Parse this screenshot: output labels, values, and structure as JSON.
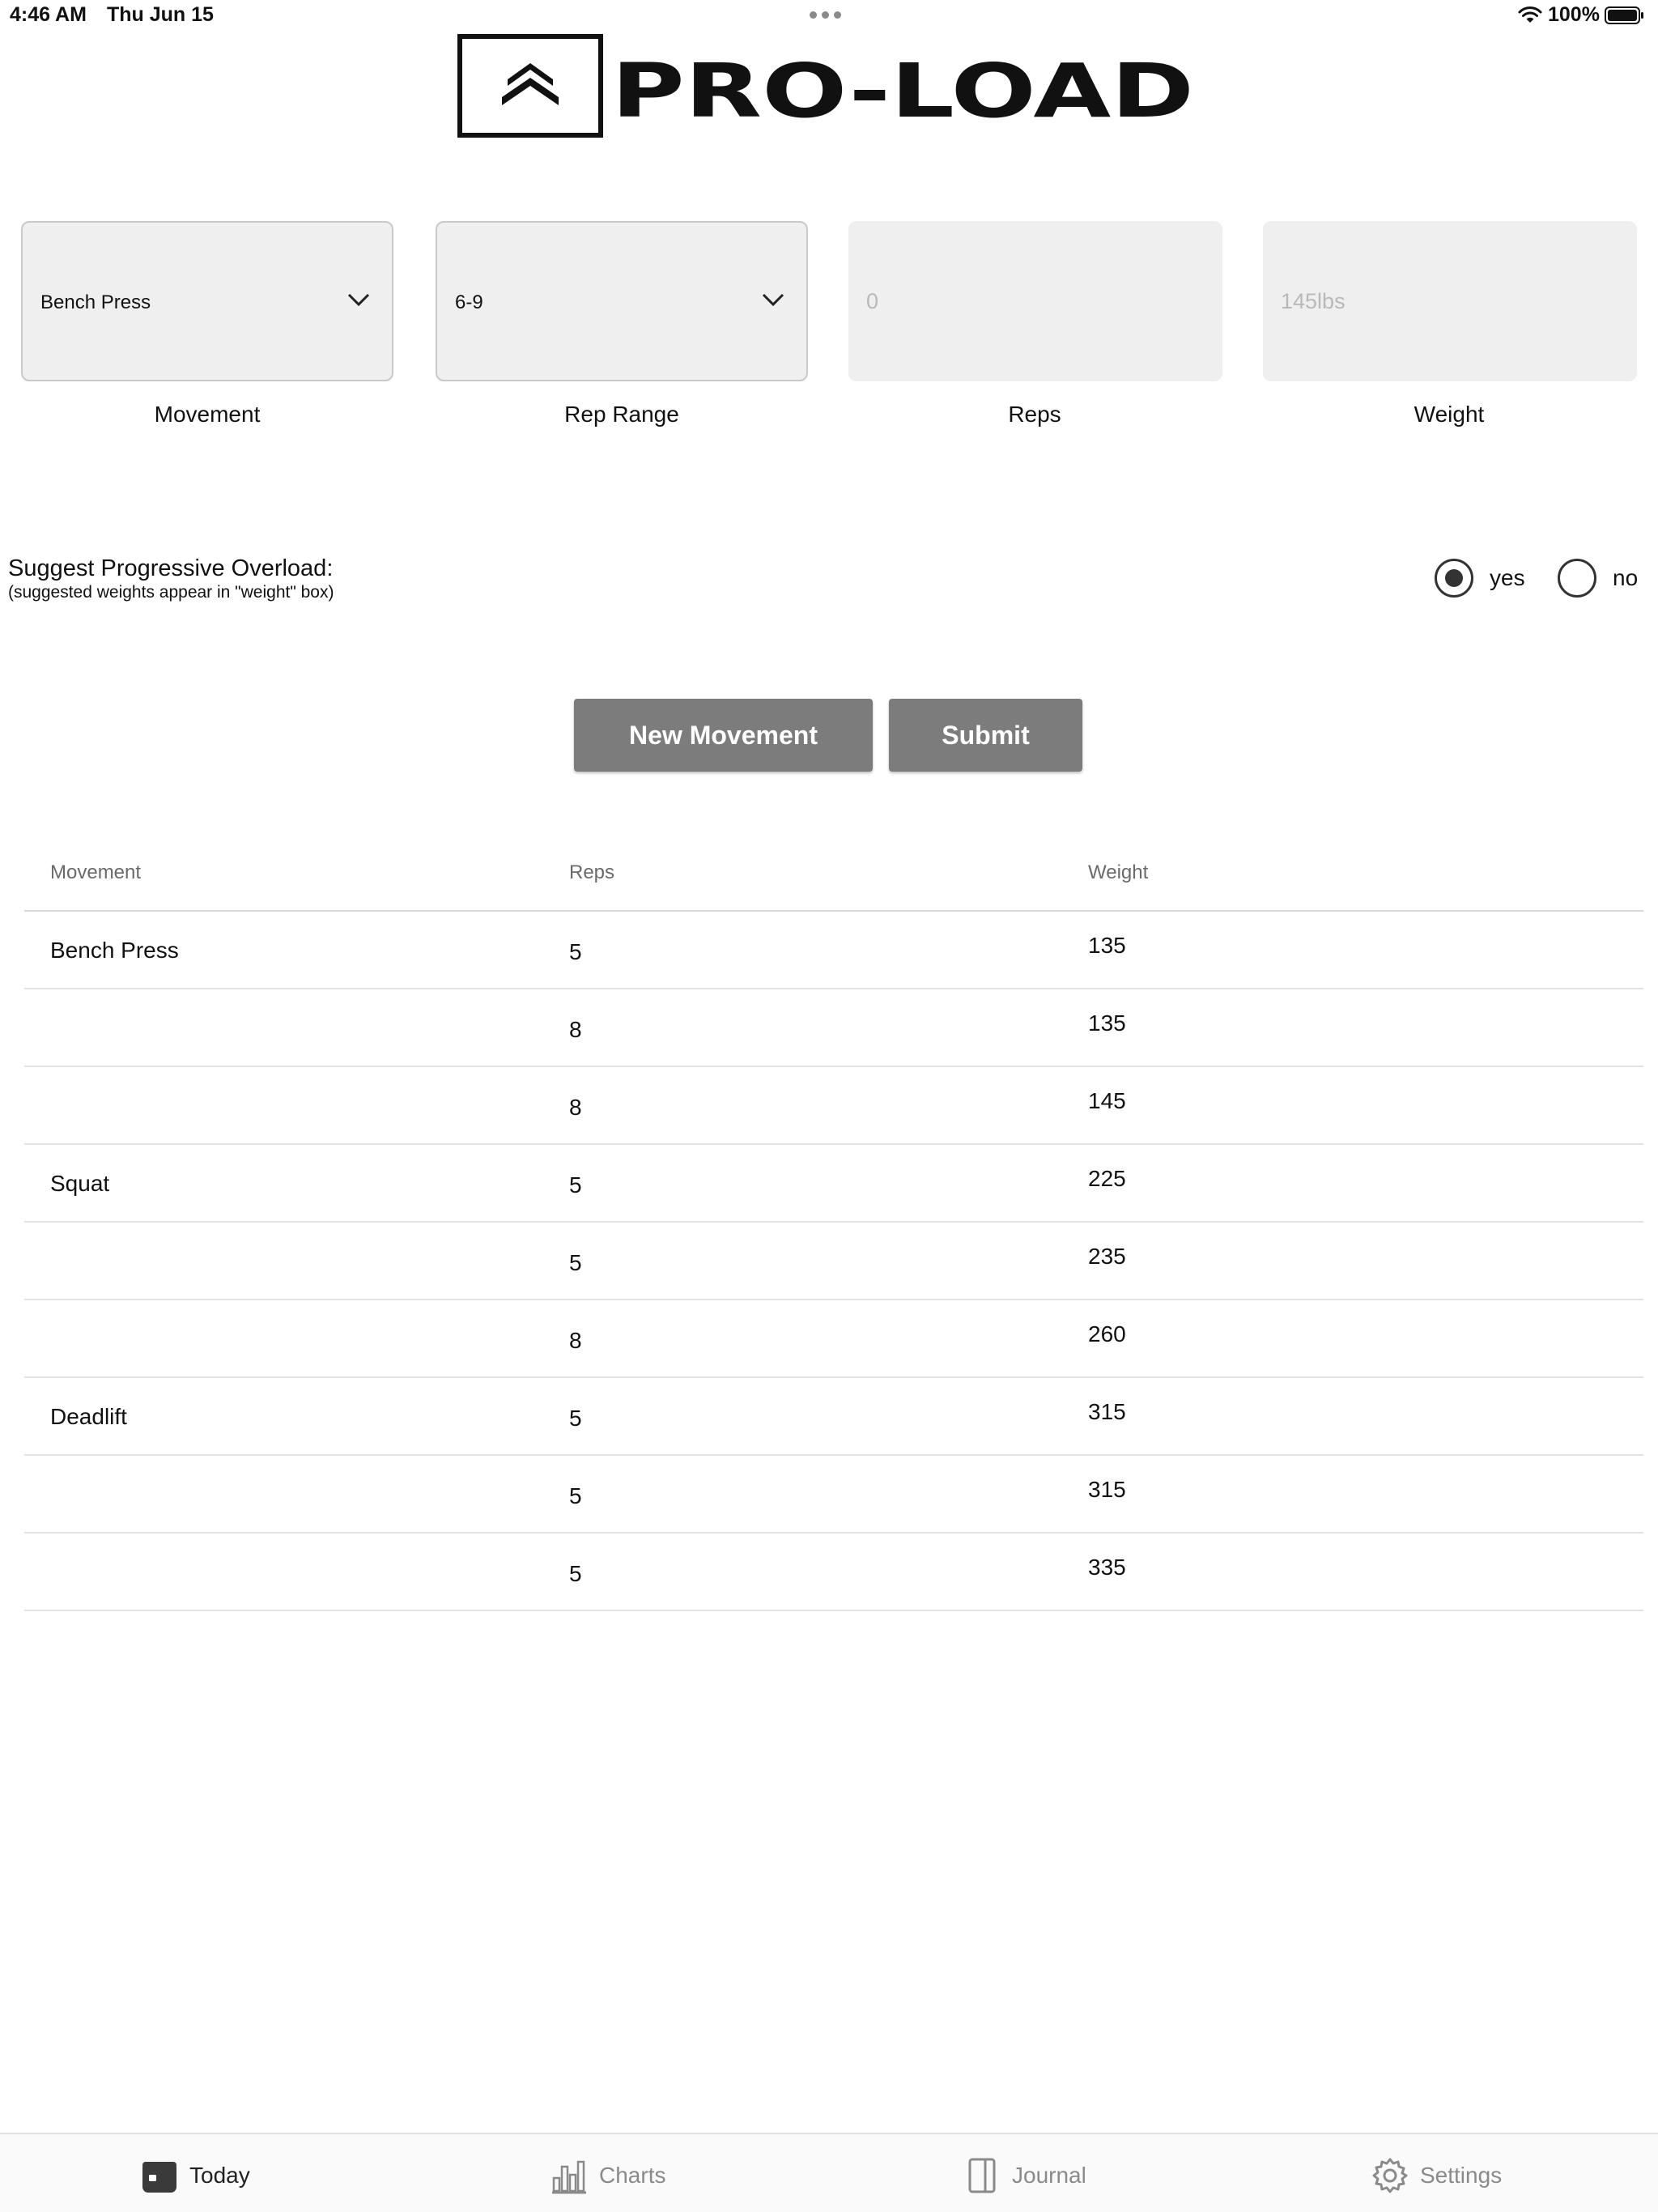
{
  "status_bar": {
    "time": "4:46 AM",
    "date": "Thu Jun 15",
    "battery": "100%"
  },
  "app": {
    "logo_text": "PRO-LOAD"
  },
  "inputs": {
    "movement": {
      "value": "Bench Press",
      "label": "Movement"
    },
    "rep_range": {
      "value": "6-9",
      "label": "Rep Range"
    },
    "reps": {
      "placeholder": "0",
      "label": "Reps"
    },
    "weight": {
      "placeholder": "145lbs",
      "label": "Weight"
    }
  },
  "overload": {
    "title": "Suggest Progressive Overload:",
    "subtitle": "(suggested weights appear in \"weight\" box)",
    "options": [
      {
        "label": "yes",
        "selected": true
      },
      {
        "label": "no",
        "selected": false
      }
    ]
  },
  "buttons": {
    "new_movement": "New Movement",
    "submit": "Submit"
  },
  "table": {
    "headers": [
      "Movement",
      "Reps",
      "Weight"
    ],
    "rows": [
      {
        "movement": "Bench Press",
        "reps": "5",
        "weight": "135"
      },
      {
        "movement": "",
        "reps": "8",
        "weight": "135"
      },
      {
        "movement": "",
        "reps": "8",
        "weight": "145"
      },
      {
        "movement": "Squat",
        "reps": "5",
        "weight": "225"
      },
      {
        "movement": "",
        "reps": "5",
        "weight": "235"
      },
      {
        "movement": "",
        "reps": "8",
        "weight": "260"
      },
      {
        "movement": "Deadlift",
        "reps": "5",
        "weight": "315"
      },
      {
        "movement": "",
        "reps": "5",
        "weight": "315"
      },
      {
        "movement": "",
        "reps": "5",
        "weight": "335"
      }
    ]
  },
  "tabs": [
    {
      "label": "Today",
      "icon": "calendar-icon",
      "active": true
    },
    {
      "label": "Charts",
      "icon": "bar-chart-icon",
      "active": false
    },
    {
      "label": "Journal",
      "icon": "book-icon",
      "active": false
    },
    {
      "label": "Settings",
      "icon": "gear-icon",
      "active": false
    }
  ]
}
